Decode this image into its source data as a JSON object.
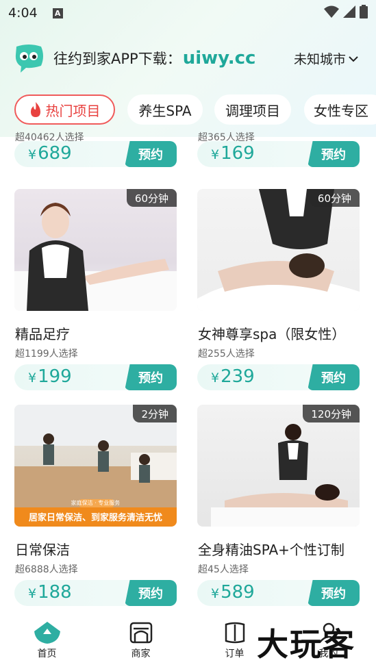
{
  "status": {
    "time": "4:04"
  },
  "brand": {
    "text": "往约到家APP下载：",
    "url": "uiwy.cc",
    "city": "未知城市"
  },
  "tabs": [
    {
      "label": "热门项目",
      "active": true
    },
    {
      "label": "养生SPA",
      "active": false
    },
    {
      "label": "调理项目",
      "active": false
    },
    {
      "label": "女性专区",
      "active": false
    }
  ],
  "cards": [
    {
      "title": "",
      "selected": "超40462人选择",
      "price": "689",
      "book": "预约"
    },
    {
      "title": "",
      "selected": "超365人选择",
      "price": "169",
      "book": "预约"
    },
    {
      "title": "精品足疗",
      "duration": "60分钟",
      "selected": "超1199人选择",
      "price": "199",
      "book": "预约"
    },
    {
      "title": "女神尊享spa（限女性）",
      "duration": "60分钟",
      "selected": "超255人选择",
      "price": "239",
      "book": "预约"
    },
    {
      "title": "日常保洁",
      "duration": "2分钟",
      "selected": "超6888人选择",
      "price": "188",
      "book": "预约",
      "banner": "居家日常保洁、到家服务清洁无忧",
      "banner_small": "家庭保洁 · 专业服务"
    },
    {
      "title": "全身精油SPA+个性订制",
      "duration": "120分钟",
      "selected": "超45人选择",
      "price": "589",
      "book": "预约"
    }
  ],
  "currency": "¥",
  "nav": [
    {
      "label": "首页",
      "active": true
    },
    {
      "label": "商家",
      "active": false
    },
    {
      "label": "订单",
      "active": false
    },
    {
      "label": "我的",
      "active": false
    }
  ],
  "watermark": "大玩客",
  "colors": {
    "accent": "#2eaea2",
    "hot": "#e8413f"
  }
}
